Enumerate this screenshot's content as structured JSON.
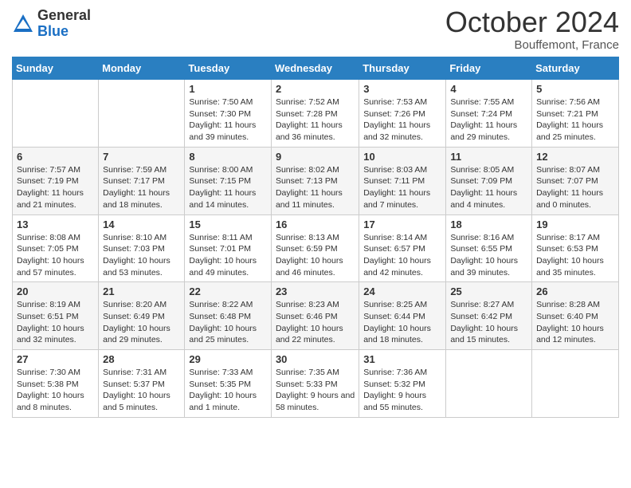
{
  "header": {
    "logo_general": "General",
    "logo_blue": "Blue",
    "month": "October 2024",
    "location": "Bouffemont, France"
  },
  "weekdays": [
    "Sunday",
    "Monday",
    "Tuesday",
    "Wednesday",
    "Thursday",
    "Friday",
    "Saturday"
  ],
  "weeks": [
    [
      {
        "day": "",
        "info": ""
      },
      {
        "day": "",
        "info": ""
      },
      {
        "day": "1",
        "info": "Sunrise: 7:50 AM\nSunset: 7:30 PM\nDaylight: 11 hours and 39 minutes."
      },
      {
        "day": "2",
        "info": "Sunrise: 7:52 AM\nSunset: 7:28 PM\nDaylight: 11 hours and 36 minutes."
      },
      {
        "day": "3",
        "info": "Sunrise: 7:53 AM\nSunset: 7:26 PM\nDaylight: 11 hours and 32 minutes."
      },
      {
        "day": "4",
        "info": "Sunrise: 7:55 AM\nSunset: 7:24 PM\nDaylight: 11 hours and 29 minutes."
      },
      {
        "day": "5",
        "info": "Sunrise: 7:56 AM\nSunset: 7:21 PM\nDaylight: 11 hours and 25 minutes."
      }
    ],
    [
      {
        "day": "6",
        "info": "Sunrise: 7:57 AM\nSunset: 7:19 PM\nDaylight: 11 hours and 21 minutes."
      },
      {
        "day": "7",
        "info": "Sunrise: 7:59 AM\nSunset: 7:17 PM\nDaylight: 11 hours and 18 minutes."
      },
      {
        "day": "8",
        "info": "Sunrise: 8:00 AM\nSunset: 7:15 PM\nDaylight: 11 hours and 14 minutes."
      },
      {
        "day": "9",
        "info": "Sunrise: 8:02 AM\nSunset: 7:13 PM\nDaylight: 11 hours and 11 minutes."
      },
      {
        "day": "10",
        "info": "Sunrise: 8:03 AM\nSunset: 7:11 PM\nDaylight: 11 hours and 7 minutes."
      },
      {
        "day": "11",
        "info": "Sunrise: 8:05 AM\nSunset: 7:09 PM\nDaylight: 11 hours and 4 minutes."
      },
      {
        "day": "12",
        "info": "Sunrise: 8:07 AM\nSunset: 7:07 PM\nDaylight: 11 hours and 0 minutes."
      }
    ],
    [
      {
        "day": "13",
        "info": "Sunrise: 8:08 AM\nSunset: 7:05 PM\nDaylight: 10 hours and 57 minutes."
      },
      {
        "day": "14",
        "info": "Sunrise: 8:10 AM\nSunset: 7:03 PM\nDaylight: 10 hours and 53 minutes."
      },
      {
        "day": "15",
        "info": "Sunrise: 8:11 AM\nSunset: 7:01 PM\nDaylight: 10 hours and 49 minutes."
      },
      {
        "day": "16",
        "info": "Sunrise: 8:13 AM\nSunset: 6:59 PM\nDaylight: 10 hours and 46 minutes."
      },
      {
        "day": "17",
        "info": "Sunrise: 8:14 AM\nSunset: 6:57 PM\nDaylight: 10 hours and 42 minutes."
      },
      {
        "day": "18",
        "info": "Sunrise: 8:16 AM\nSunset: 6:55 PM\nDaylight: 10 hours and 39 minutes."
      },
      {
        "day": "19",
        "info": "Sunrise: 8:17 AM\nSunset: 6:53 PM\nDaylight: 10 hours and 35 minutes."
      }
    ],
    [
      {
        "day": "20",
        "info": "Sunrise: 8:19 AM\nSunset: 6:51 PM\nDaylight: 10 hours and 32 minutes."
      },
      {
        "day": "21",
        "info": "Sunrise: 8:20 AM\nSunset: 6:49 PM\nDaylight: 10 hours and 29 minutes."
      },
      {
        "day": "22",
        "info": "Sunrise: 8:22 AM\nSunset: 6:48 PM\nDaylight: 10 hours and 25 minutes."
      },
      {
        "day": "23",
        "info": "Sunrise: 8:23 AM\nSunset: 6:46 PM\nDaylight: 10 hours and 22 minutes."
      },
      {
        "day": "24",
        "info": "Sunrise: 8:25 AM\nSunset: 6:44 PM\nDaylight: 10 hours and 18 minutes."
      },
      {
        "day": "25",
        "info": "Sunrise: 8:27 AM\nSunset: 6:42 PM\nDaylight: 10 hours and 15 minutes."
      },
      {
        "day": "26",
        "info": "Sunrise: 8:28 AM\nSunset: 6:40 PM\nDaylight: 10 hours and 12 minutes."
      }
    ],
    [
      {
        "day": "27",
        "info": "Sunrise: 7:30 AM\nSunset: 5:38 PM\nDaylight: 10 hours and 8 minutes."
      },
      {
        "day": "28",
        "info": "Sunrise: 7:31 AM\nSunset: 5:37 PM\nDaylight: 10 hours and 5 minutes."
      },
      {
        "day": "29",
        "info": "Sunrise: 7:33 AM\nSunset: 5:35 PM\nDaylight: 10 hours and 1 minute."
      },
      {
        "day": "30",
        "info": "Sunrise: 7:35 AM\nSunset: 5:33 PM\nDaylight: 9 hours and 58 minutes."
      },
      {
        "day": "31",
        "info": "Sunrise: 7:36 AM\nSunset: 5:32 PM\nDaylight: 9 hours and 55 minutes."
      },
      {
        "day": "",
        "info": ""
      },
      {
        "day": "",
        "info": ""
      }
    ]
  ]
}
